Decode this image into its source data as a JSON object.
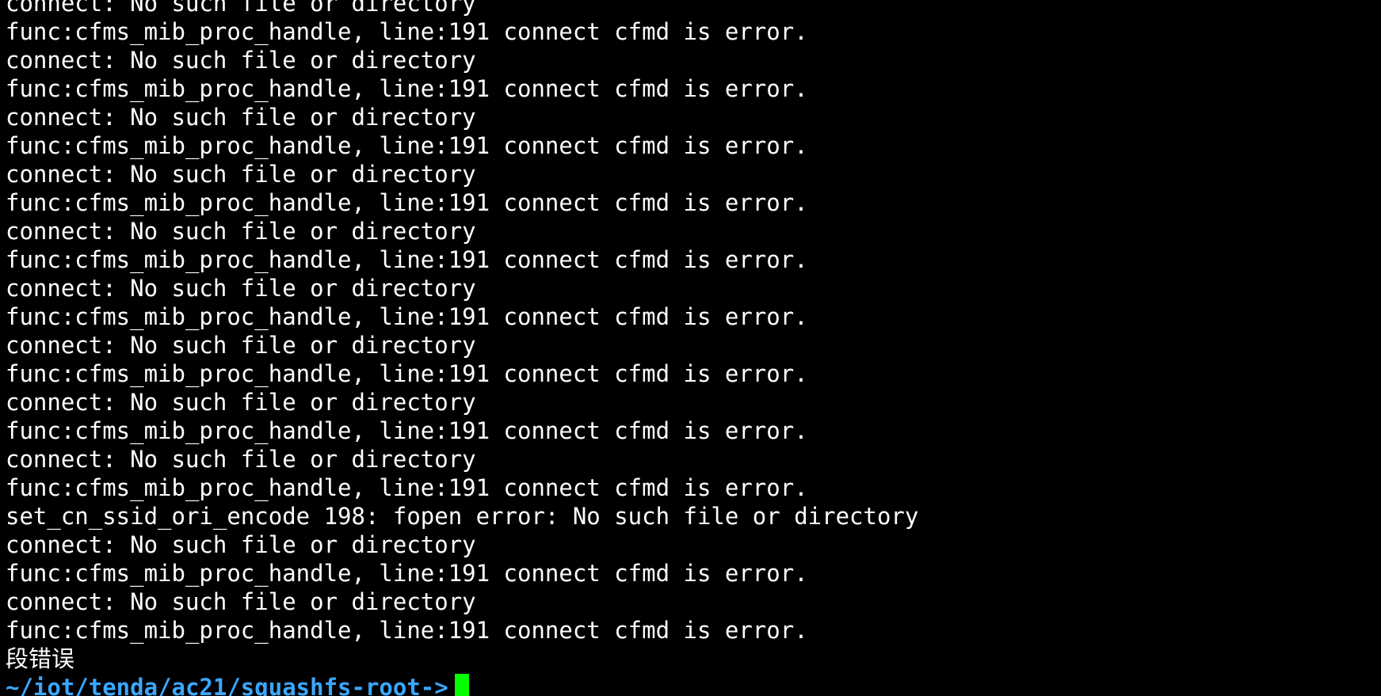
{
  "terminal": {
    "lines": [
      "connect: No such file or directory",
      "func:cfms_mib_proc_handle, line:191 connect cfmd is error.",
      "connect: No such file or directory",
      "func:cfms_mib_proc_handle, line:191 connect cfmd is error.",
      "connect: No such file or directory",
      "func:cfms_mib_proc_handle, line:191 connect cfmd is error.",
      "connect: No such file or directory",
      "func:cfms_mib_proc_handle, line:191 connect cfmd is error.",
      "connect: No such file or directory",
      "func:cfms_mib_proc_handle, line:191 connect cfmd is error.",
      "connect: No such file or directory",
      "func:cfms_mib_proc_handle, line:191 connect cfmd is error.",
      "connect: No such file or directory",
      "func:cfms_mib_proc_handle, line:191 connect cfmd is error.",
      "connect: No such file or directory",
      "func:cfms_mib_proc_handle, line:191 connect cfmd is error.",
      "connect: No such file or directory",
      "func:cfms_mib_proc_handle, line:191 connect cfmd is error.",
      "set_cn_ssid_ori_encode 198: fopen error: No such file or directory",
      "connect: No such file or directory",
      "func:cfms_mib_proc_handle, line:191 connect cfmd is error.",
      "connect: No such file or directory",
      "func:cfms_mib_proc_handle, line:191 connect cfmd is error.",
      "段错误"
    ],
    "prompt": {
      "path": "~/iot/tenda/ac21/squashfs-root",
      "arrow": "->"
    },
    "colors": {
      "background": "#000000",
      "text": "#ffffff",
      "prompt": "#3aa7ff",
      "cursor": "#00ff00"
    }
  }
}
